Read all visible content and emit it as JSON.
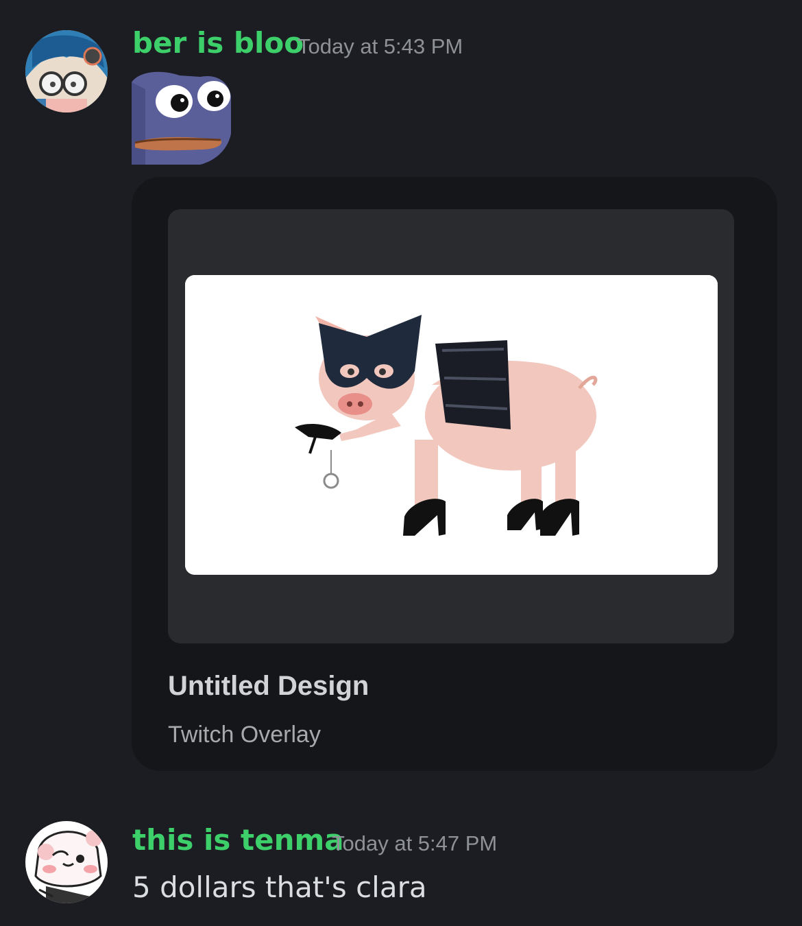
{
  "messages": [
    {
      "author": "ber is bloo",
      "timestamp": "Today at 5:43 PM",
      "avatar_icon": "anime-avatar-blue-hair-glasses",
      "emote_icon": "pepe-frog-wide-eyes-emote",
      "embed": {
        "title": "Untitled Design",
        "subtitle": "Twitch Overlay",
        "image_icon": "pig-in-mask-and-heels-image"
      }
    },
    {
      "author": "this is tenma",
      "timestamp": "Today at 5:47 PM",
      "avatar_icon": "anime-avatar-white-hair-blush",
      "text": "5 dollars that's clara"
    }
  ],
  "colors": {
    "background": "#1c1d22",
    "author_name": "#3ccf6a",
    "timestamp": "#8e9297",
    "embed_bg": "#151619",
    "embed_media_bg": "#2a2b2f"
  }
}
